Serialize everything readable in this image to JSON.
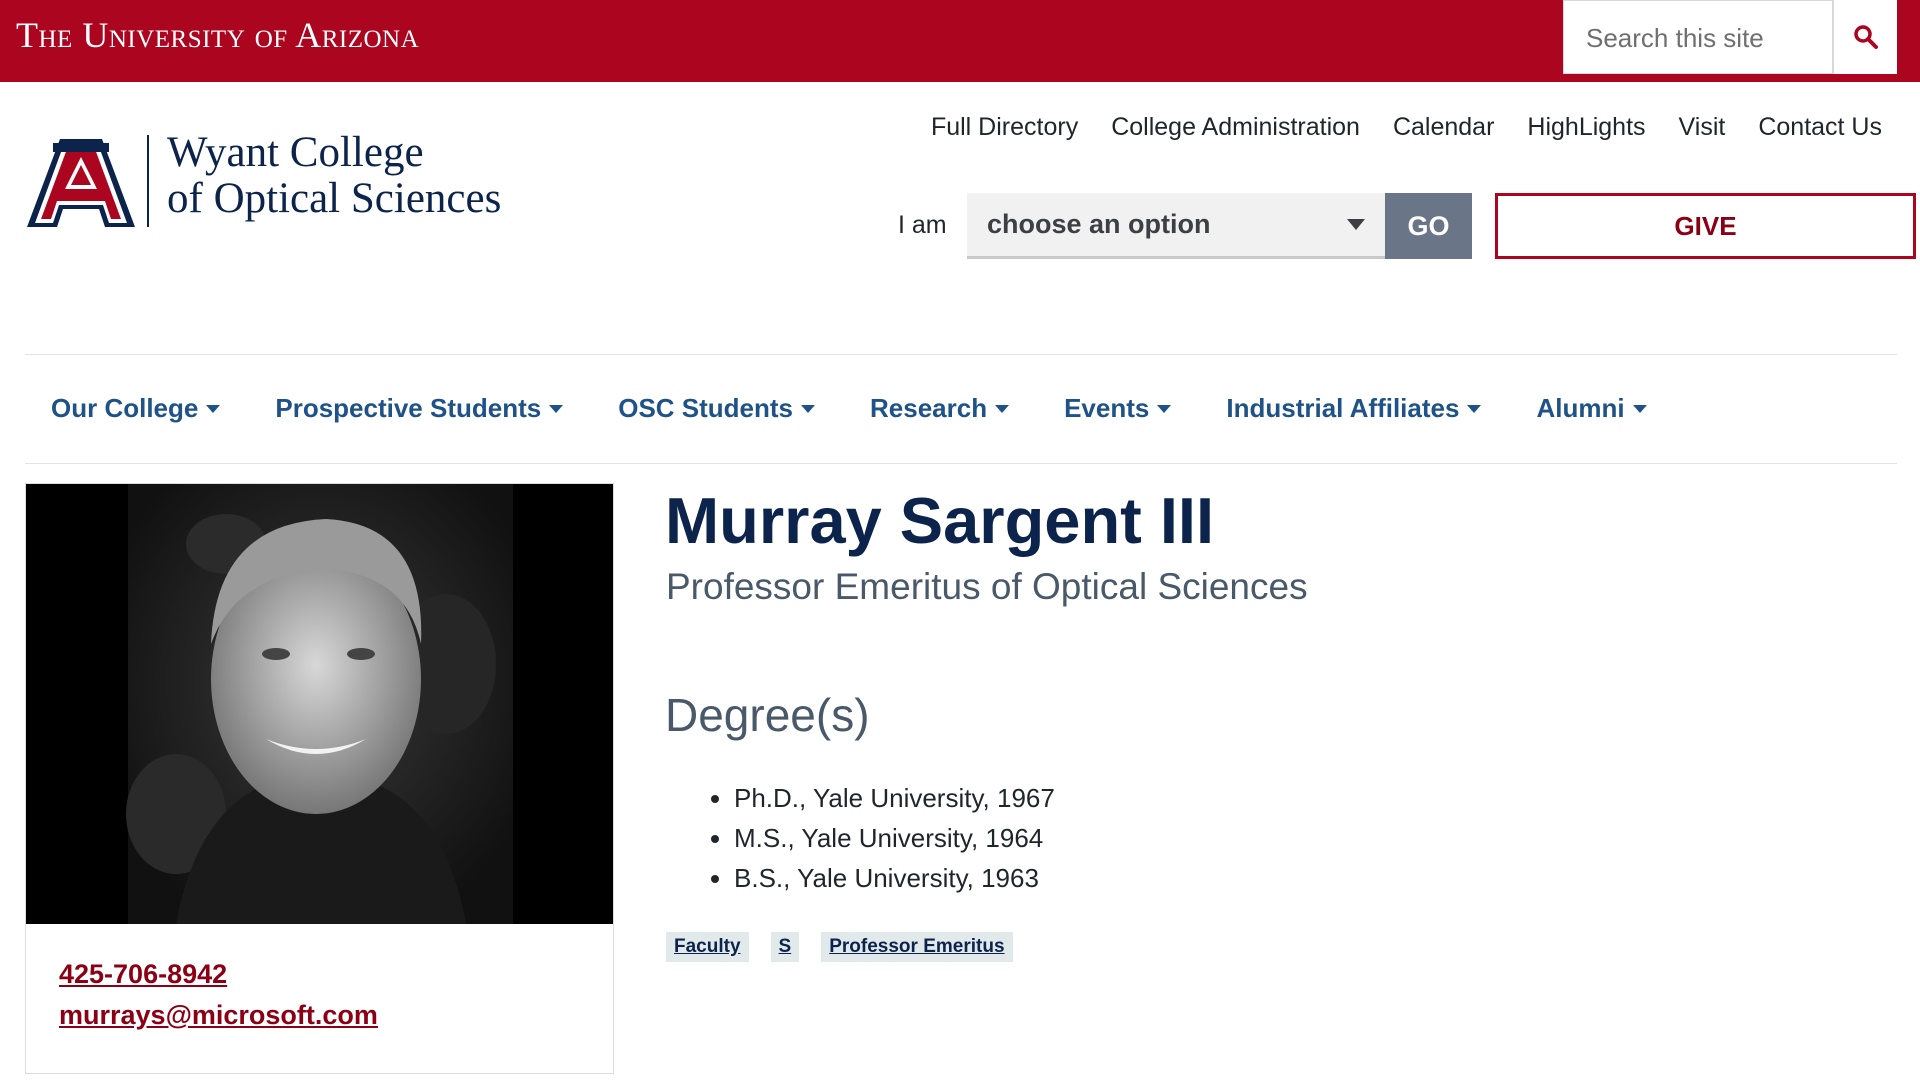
{
  "header": {
    "university_name": "The University of Arizona",
    "search": {
      "placeholder": "Search this site"
    }
  },
  "brand": {
    "college_line1": "Wyant College",
    "college_line2": "of Optical Sciences"
  },
  "utility_nav": [
    "Full Directory",
    "College Administration",
    "Calendar",
    "HighLights",
    "Visit",
    "Contact Us"
  ],
  "audience_selector": {
    "label": "I am",
    "selected": "choose an option",
    "go_label": "GO",
    "give_label": "GIVE"
  },
  "main_nav": [
    "Our College",
    "Prospective Students",
    "OSC Students",
    "Research",
    "Events",
    "Industrial Affiliates",
    "Alumni"
  ],
  "profile": {
    "name": "Murray Sargent III",
    "title": "Professor Emeritus of Optical Sciences",
    "phone": "425-706-8942",
    "email": "murrays@microsoft.com",
    "degrees_heading": "Degree(s)",
    "degrees": [
      "Ph.D., Yale University, 1967",
      "M.S., Yale University, 1964",
      "B.S., Yale University, 1963"
    ],
    "tags": [
      "Faculty",
      "S",
      "Professor Emeritus"
    ]
  },
  "colors": {
    "brand_red": "#ab0520",
    "brand_navy": "#0c234b",
    "nav_blue": "#1e5288",
    "link_red": "#8b0015",
    "go_gray": "#6a7687"
  },
  "icons": {
    "search": "search-icon",
    "dropdown": "chevron-down-icon"
  }
}
